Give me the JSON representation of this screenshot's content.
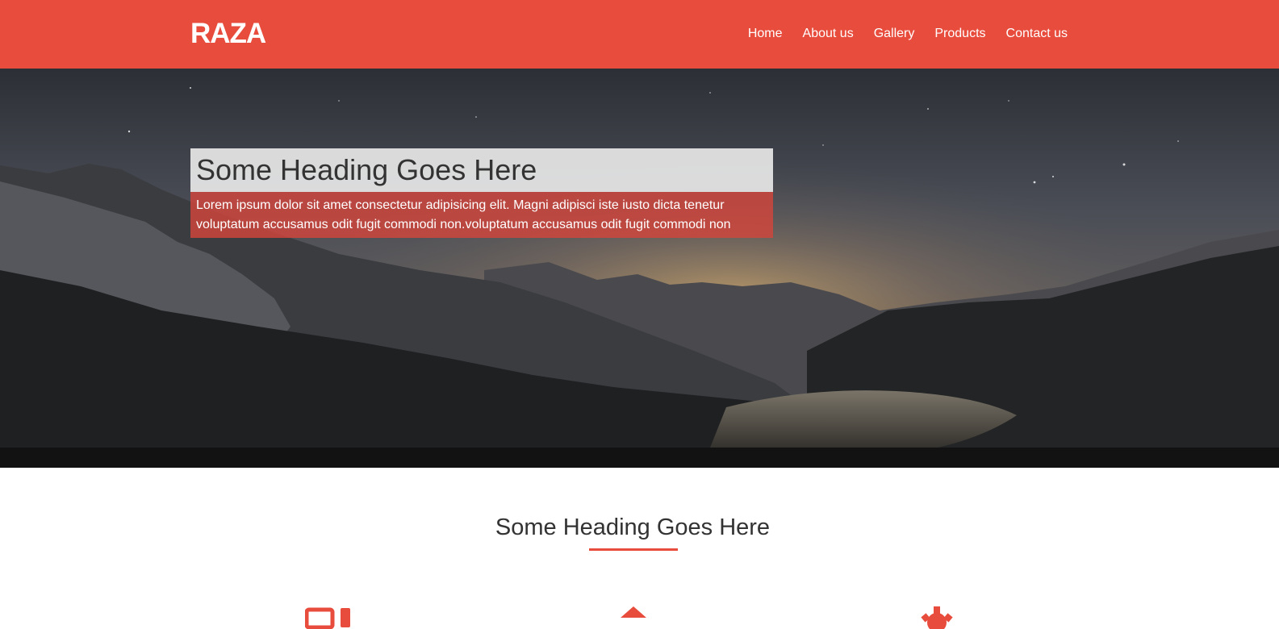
{
  "header": {
    "logo": "RAZA",
    "nav": [
      {
        "label": "Home"
      },
      {
        "label": "About us"
      },
      {
        "label": "Gallery"
      },
      {
        "label": "Products"
      },
      {
        "label": "Contact us"
      }
    ]
  },
  "hero": {
    "heading": "Some Heading Goes Here",
    "text": "Lorem ipsum dolor sit amet consectetur adipisicing elit. Magni adipisci iste iusto dicta tenetur voluptatum accusamus odit fugit commodi non.voluptatum accusamus odit fugit commodi non"
  },
  "section": {
    "title": "Some Heading Goes Here"
  },
  "features": [
    {
      "icon": "devices-icon"
    },
    {
      "icon": "home-icon"
    },
    {
      "icon": "gear-icon"
    }
  ],
  "colors": {
    "accent": "#e84c3d",
    "text_dark": "#333333",
    "white": "#ffffff"
  }
}
